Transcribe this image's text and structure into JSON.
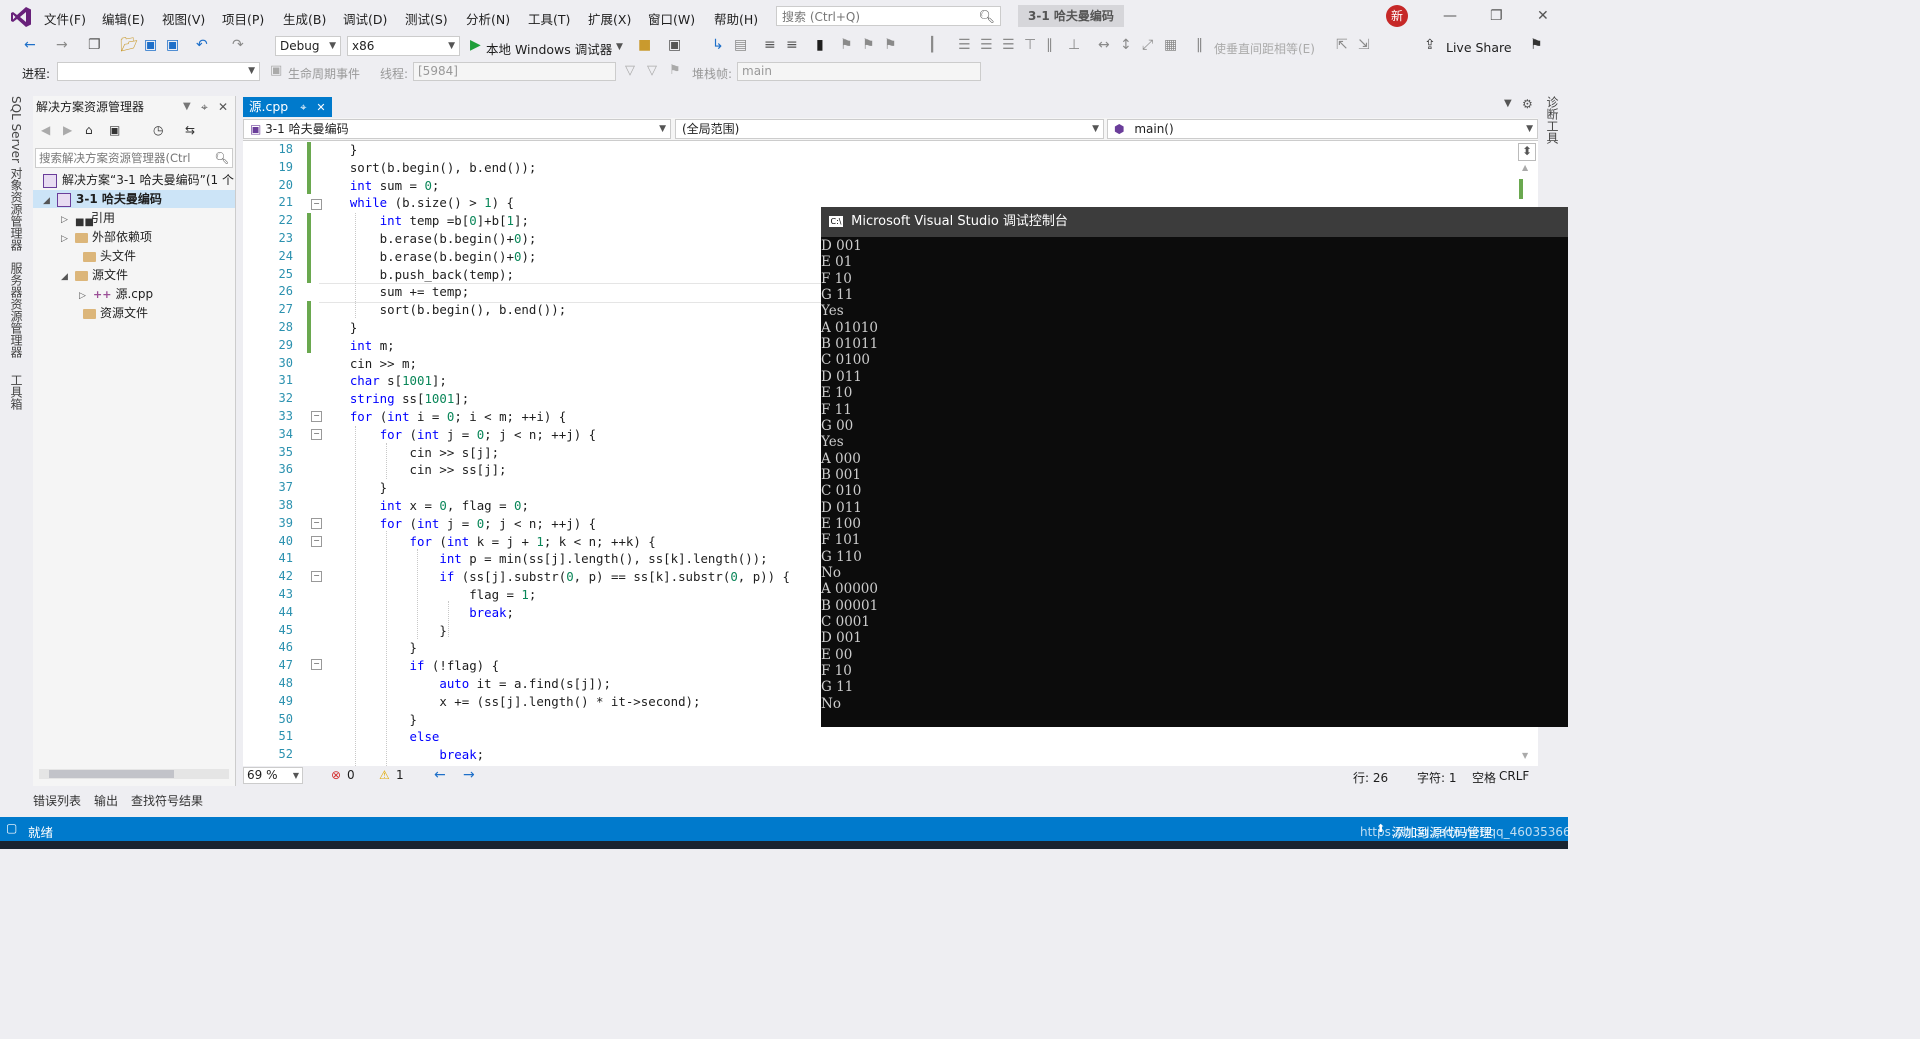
{
  "menu": {
    "items": [
      "文件(F)",
      "编辑(E)",
      "视图(V)",
      "项目(P)",
      "生成(B)",
      "调试(D)",
      "测试(S)",
      "分析(N)",
      "工具(T)",
      "扩展(X)",
      "窗口(W)",
      "帮助(H)"
    ],
    "search_placeholder": "搜索 (Ctrl+Q)",
    "solution_title": "3-1 哈夫曼编码",
    "avatar_text": "新"
  },
  "toolbar": {
    "config": "Debug",
    "platform": "x86",
    "debugger": "本地 Windows 调试器",
    "align_label": "使垂直间距相等(E)",
    "live_share": "Live Share"
  },
  "toolbar2": {
    "process_label": "进程:",
    "lifecycle_label": "生命周期事件",
    "thread_label": "线程:",
    "thread_value": "[5984]",
    "stack_label": "堆栈帧:",
    "stack_value": "main"
  },
  "left_tabs": [
    "SQL Server 对象资源管理器",
    "服务器资源管理器",
    "工具箱"
  ],
  "right_tabs": [
    "诊断工具"
  ],
  "solution_explorer": {
    "title": "解决方案资源管理器",
    "search_placeholder": "搜索解决方案资源管理器(Ctrl",
    "items": [
      {
        "label": "解决方案“3-1 哈夫曼编码”(1 个"
      },
      {
        "label": "3-1 哈夫曼编码"
      },
      {
        "label": "引用"
      },
      {
        "label": "外部依赖项"
      },
      {
        "label": "头文件"
      },
      {
        "label": "源文件"
      },
      {
        "label": "源.cpp"
      },
      {
        "label": "资源文件"
      }
    ]
  },
  "bottom_tabs": [
    "错误列表",
    "输出",
    "查找符号结果"
  ],
  "editor": {
    "tab_name": "源.cpp",
    "nav_project": "3-1 哈夫曼编码",
    "nav_scope": "(全局范围)",
    "nav_function": "main()",
    "zoom": "69 %",
    "errors": "0",
    "warnings": "1",
    "line": "行: 26",
    "col": "字符: 1",
    "spaces": "空格",
    "eol": "CRLF",
    "lines": [
      {
        "n": "18",
        "t": "    }"
      },
      {
        "n": "19",
        "t": "    sort(b.begin(), b.end());"
      },
      {
        "n": "20",
        "t": "    int sum = 0;"
      },
      {
        "n": "21",
        "t": "    while (b.size() > 1) {"
      },
      {
        "n": "22",
        "t": "        int temp =b[0]+b[1];"
      },
      {
        "n": "23",
        "t": "        b.erase(b.begin()+0);"
      },
      {
        "n": "24",
        "t": "        b.erase(b.begin()+0);"
      },
      {
        "n": "25",
        "t": "        b.push_back(temp);"
      },
      {
        "n": "26",
        "t": "        sum += temp;"
      },
      {
        "n": "27",
        "t": "        sort(b.begin(), b.end());"
      },
      {
        "n": "28",
        "t": "    }"
      },
      {
        "n": "29",
        "t": "    int m;"
      },
      {
        "n": "30",
        "t": "    cin >> m;"
      },
      {
        "n": "31",
        "t": "    char s[1001];"
      },
      {
        "n": "32",
        "t": "    string ss[1001];"
      },
      {
        "n": "33",
        "t": "    for (int i = 0; i < m; ++i) {"
      },
      {
        "n": "34",
        "t": "        for (int j = 0; j < n; ++j) {"
      },
      {
        "n": "35",
        "t": "            cin >> s[j];"
      },
      {
        "n": "36",
        "t": "            cin >> ss[j];"
      },
      {
        "n": "37",
        "t": "        }"
      },
      {
        "n": "38",
        "t": "        int x = 0, flag = 0;"
      },
      {
        "n": "39",
        "t": "        for (int j = 0; j < n; ++j) {"
      },
      {
        "n": "40",
        "t": "            for (int k = j + 1; k < n; ++k) {"
      },
      {
        "n": "41",
        "t": "                int p = min(ss[j].length(), ss[k].length());"
      },
      {
        "n": "42",
        "t": "                if (ss[j].substr(0, p) == ss[k].substr(0, p)) {"
      },
      {
        "n": "43",
        "t": "                    flag = 1;"
      },
      {
        "n": "44",
        "t": "                    break;"
      },
      {
        "n": "45",
        "t": "                }"
      },
      {
        "n": "46",
        "t": "            }"
      },
      {
        "n": "47",
        "t": "            if (!flag) {"
      },
      {
        "n": "48",
        "t": "                auto it = a.find(s[j]);"
      },
      {
        "n": "49",
        "t": "                x += (ss[j].length() * it->second);"
      },
      {
        "n": "50",
        "t": "            }"
      },
      {
        "n": "51",
        "t": "            else"
      },
      {
        "n": "52",
        "t": "                break;"
      }
    ]
  },
  "console": {
    "title": "Microsoft Visual Studio 调试控制台",
    "lines": [
      "D 001",
      "E 01",
      "F 10",
      "G 11",
      "Yes",
      "A 01010",
      "B 01011",
      "C 0100",
      "D 011",
      "E 10",
      "F 11",
      "G 00",
      "Yes",
      "A 000",
      "B 001",
      "C 010",
      "D 011",
      "E 100",
      "F 101",
      "G 110",
      "No",
      "A 00000",
      "B 00001",
      "C 0001",
      "D 001",
      "E 00",
      "F 10",
      "G 11",
      "No"
    ]
  },
  "statusbar": {
    "ready": "就绪",
    "source_control": "添加到源代码管理",
    "watermark": "https://blog.csdn.net/qq_46035366"
  }
}
